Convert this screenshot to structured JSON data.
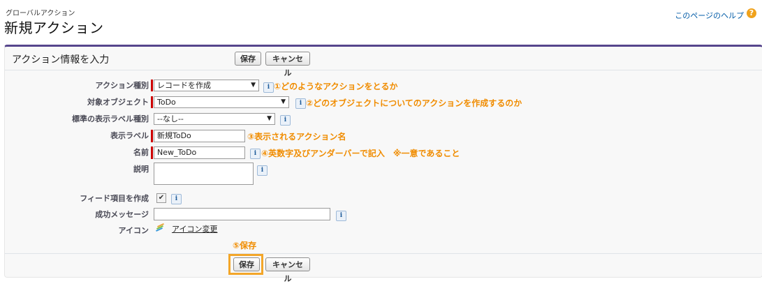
{
  "header": {
    "subtitle": "グローバルアクション",
    "title": "新規アクション",
    "help_link": "このページのヘルプ",
    "help_icon": "?"
  },
  "panel": {
    "title": "アクション情報を入力",
    "save_label": "保存",
    "cancel_label": "キャンセル"
  },
  "form": {
    "action_type": {
      "label": "アクション種別",
      "value": "レコードを作成"
    },
    "target_object": {
      "label": "対象オブジェクト",
      "value": "ToDo"
    },
    "standard_label_type": {
      "label": "標準の表示ラベル種別",
      "value": "--なし--"
    },
    "display_label": {
      "label": "表示ラベル",
      "value": "新規ToDo"
    },
    "name": {
      "label": "名前",
      "value": "New_ToDo"
    },
    "description": {
      "label": "説明",
      "value": ""
    },
    "create_feed_item": {
      "label": "フィード項目を作成",
      "checked": true,
      "check_mark": "✔"
    },
    "success_message": {
      "label": "成功メッセージ",
      "value": ""
    },
    "icon": {
      "label": "アイコン",
      "link": "アイコン変更"
    },
    "info_glyph": "i"
  },
  "annotations": {
    "a1": "①どのようなアクションをとるか",
    "a2": "②どのオブジェクトについてのアクションを作成するのか",
    "a3": "③表示されるアクション名",
    "a4": "④英数字及びアンダーバーで記入　※一意であること",
    "a5": "⑤保存"
  },
  "colors": {
    "accent_bar": "#56458c",
    "required": "#cc0000",
    "annotation": "#f08c00",
    "link": "#015ba7"
  }
}
